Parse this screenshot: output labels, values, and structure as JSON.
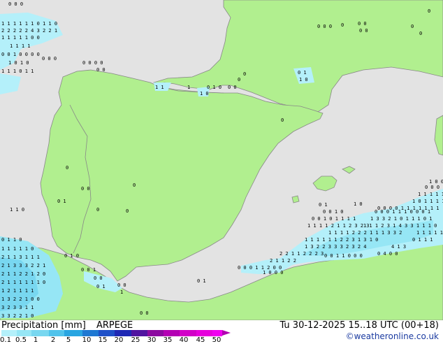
{
  "header": {
    "title": "Precipitation [mm]",
    "model": "ARPEGE",
    "valid_time": "Tu 30-12-2025 15..18 UTC (00+18)",
    "credit": "©weatheronline.co.uk"
  },
  "legend": {
    "ticks": [
      "0.1",
      "0.5",
      "1",
      "2",
      "5",
      "10",
      "15",
      "20",
      "25",
      "30",
      "35",
      "40",
      "45",
      "50"
    ],
    "colors": [
      "#b4f0fa",
      "#96e6f5",
      "#78d7f0",
      "#50c3eb",
      "#28a5e1",
      "#1e78d2",
      "#1e50c8",
      "#1e28b4",
      "#5014a0",
      "#8c0aa0",
      "#b400b4",
      "#d200c8",
      "#e600dc",
      "#f000f0"
    ]
  },
  "map": {
    "colors": {
      "sea": "#e3e3e3",
      "land": "#b1ef8f",
      "border": "#888888",
      "precip_light": "#b4f0fa",
      "precip_moderate": "#96e6f5",
      "precip_heavy": "#78d7f0"
    },
    "regions": [
      "Iberian Peninsula",
      "France",
      "North Africa",
      "Balearic Islands",
      "Sardinia"
    ]
  }
}
